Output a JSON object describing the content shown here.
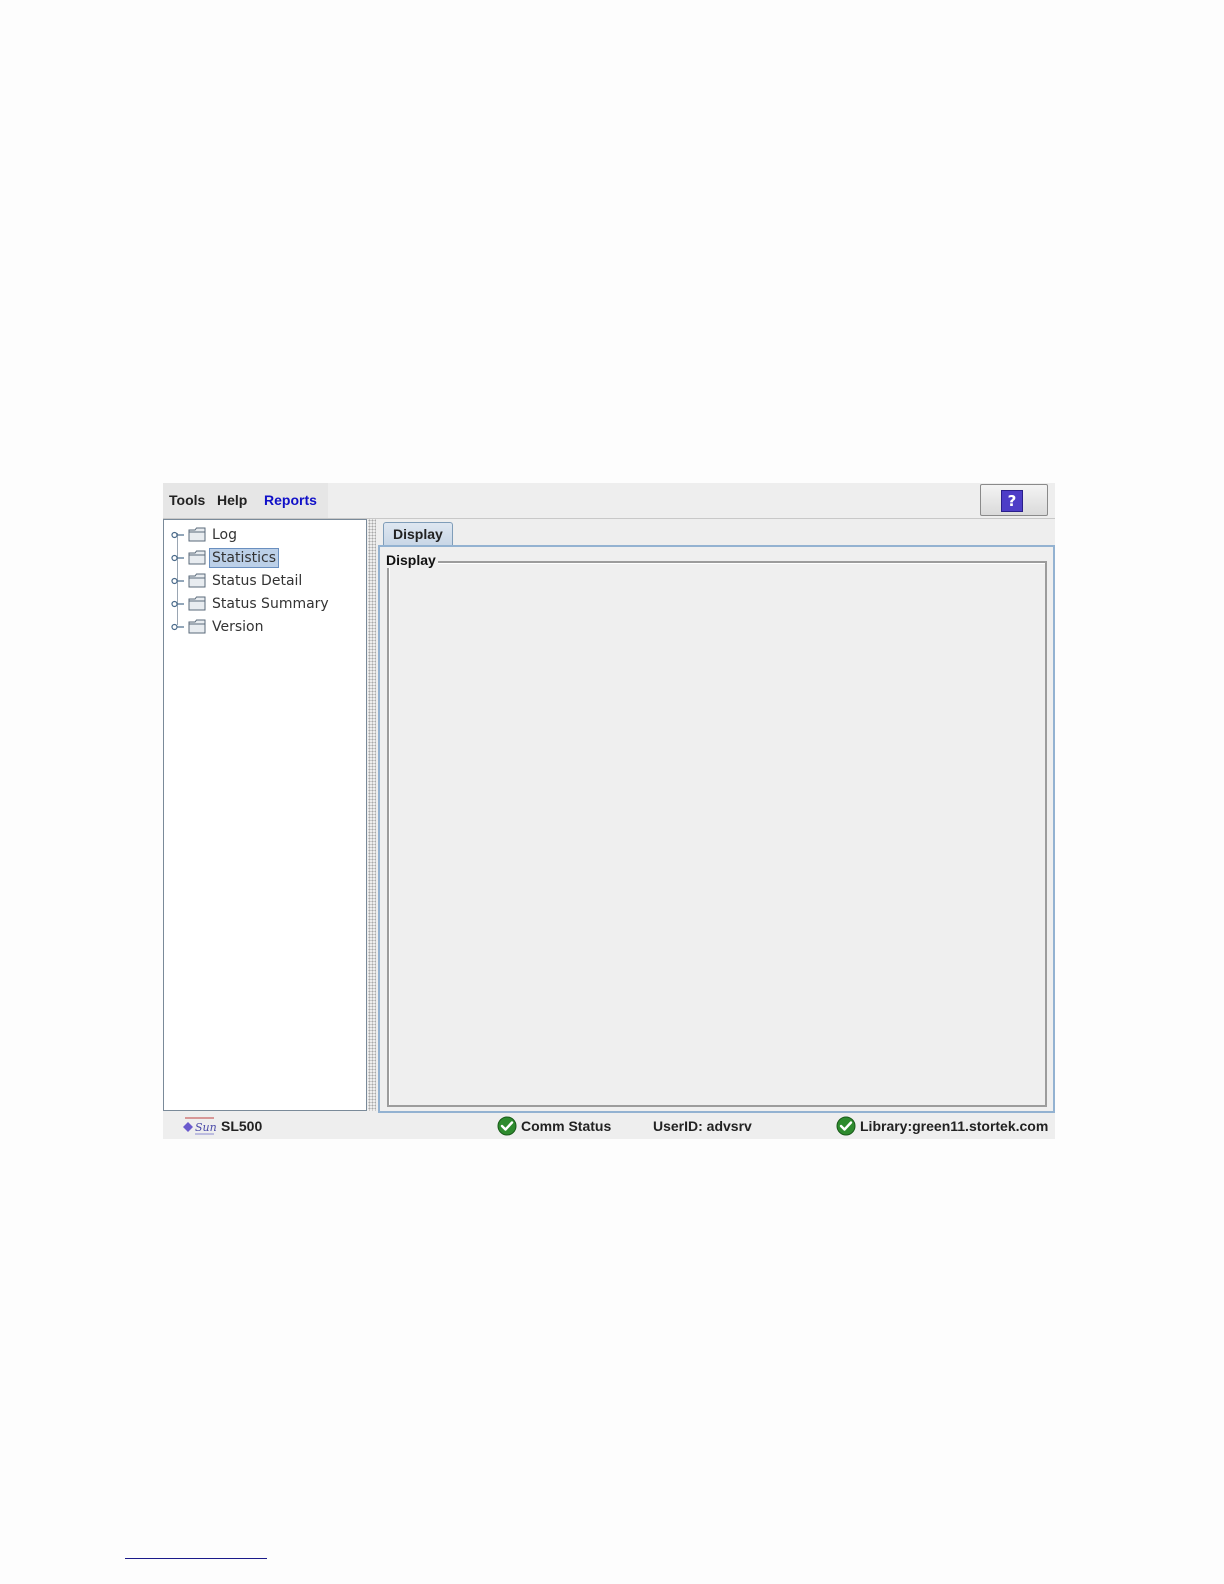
{
  "menubar": {
    "items": [
      {
        "label": "Tools"
      },
      {
        "label": "Help"
      },
      {
        "label": "Reports"
      }
    ],
    "help_button_glyph": "?"
  },
  "tree": {
    "items": [
      {
        "label": "Log"
      },
      {
        "label": "Statistics",
        "selected": true
      },
      {
        "label": "Status Detail"
      },
      {
        "label": "Status Summary"
      },
      {
        "label": "Version"
      }
    ]
  },
  "content": {
    "tab_label": "Display",
    "group_title": "Display"
  },
  "statusbar": {
    "library_model": "SL500",
    "comm_status": "Comm Status",
    "user_id": "UserID: advsrv",
    "library": "Library:green11.stortek.com"
  },
  "colors": {
    "active_menu": "#1010c8",
    "selection_bg": "#bcd0e8",
    "tab_border": "#93b2d1",
    "status_ok": "#2e8b2e"
  },
  "icons": [
    "help-icon",
    "tree-handle-icon",
    "folder-icon",
    "sun-logo-icon",
    "check-circle-icon"
  ]
}
